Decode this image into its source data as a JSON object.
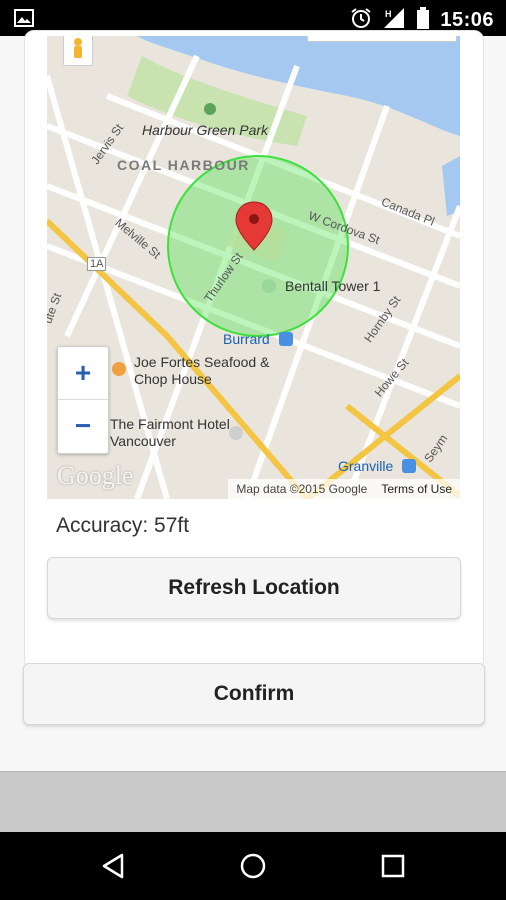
{
  "status_bar": {
    "time": "15:06",
    "icons": [
      "image-icon",
      "alarm-icon",
      "signal-h-icon",
      "battery-icon"
    ]
  },
  "map": {
    "labels": {
      "park": "Harbour Green Park",
      "district": "COAL HARBOUR",
      "tower": "Bentall Tower 1",
      "station_burrard": "Burrard",
      "restaurant": "Joe Fortes Seafood & Chop House",
      "hotel": "The Fairmont Hotel Vancouver",
      "station_granville": "Granville"
    },
    "streets": {
      "jervis": "Jervis St",
      "melville": "Melville St",
      "thurlow": "Thurlow St",
      "cordova": "W Cordova St",
      "canada": "Canada Pl",
      "hornby": "Hornby St",
      "howe": "Howe St",
      "seymour": "Seym",
      "highway": "1A",
      "bute": "ute St"
    },
    "zoom_in": "+",
    "zoom_out": "−",
    "logo": "Google",
    "attribution": "Map data ©2015 Google",
    "terms": "Terms of Use",
    "colors": {
      "water": "#a5c8f0",
      "park": "#c8e3b0",
      "land": "#e9e5dc",
      "accuracy_circle": "#3ee03e"
    }
  },
  "accuracy_text": "Accuracy: 57ft",
  "buttons": {
    "refresh": "Refresh Location",
    "confirm": "Confirm"
  }
}
